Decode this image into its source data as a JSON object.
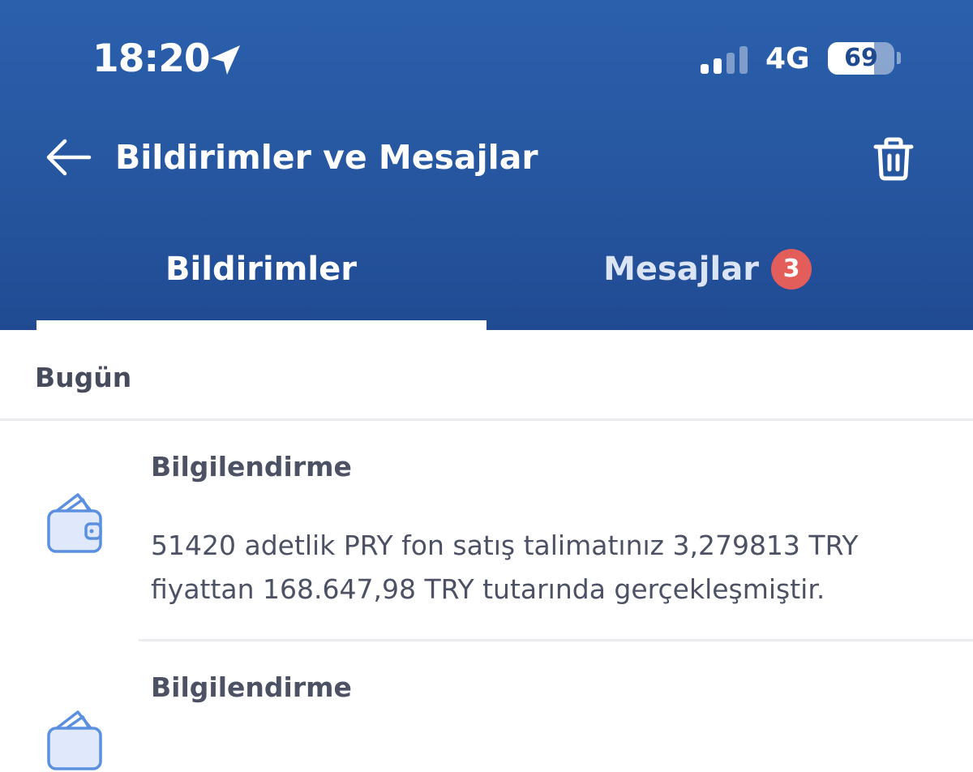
{
  "status_bar": {
    "time": "18:20",
    "network": "4G",
    "battery": "69",
    "battery_level": 0.69
  },
  "app_bar": {
    "title": "Bildirimler ve Mesajlar"
  },
  "tabs": [
    {
      "label": "Bildirimler",
      "active": true
    },
    {
      "label": "Mesajlar",
      "badge": "3",
      "active": false
    }
  ],
  "sections": [
    {
      "label": "Bugün",
      "items": [
        {
          "icon": "wallet-icon",
          "title": "Bilgilendirme",
          "body": "51420 adetlik PRY fon satış talimatınız 3,279813 TRY fiyattan 168.647,98 TRY tutarında gerçekleşmiştir."
        },
        {
          "icon": "wallet-icon",
          "title": "Bilgilendirme",
          "body": ""
        }
      ]
    }
  ],
  "colors": {
    "header": "#26569f",
    "badge": "#e35d5a",
    "icon": "#5b8fe0",
    "text": "#4c5264"
  }
}
